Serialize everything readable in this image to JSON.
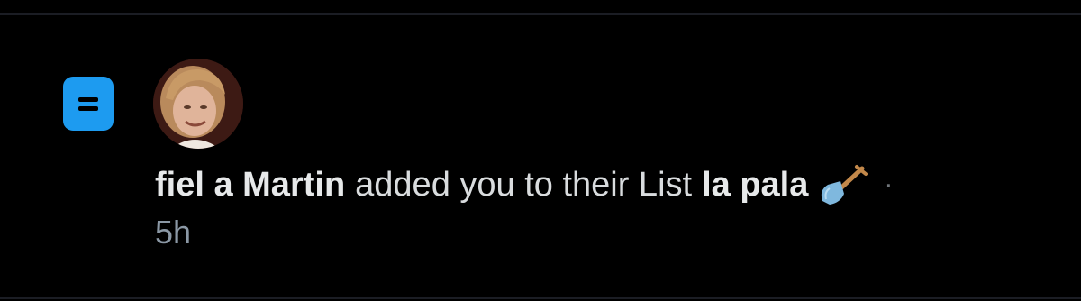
{
  "notification": {
    "icon": "list-icon",
    "avatar_icon": "user-avatar",
    "user_name": "fiel a Martin",
    "action_text": "added you to their List",
    "list_name": "la pala",
    "list_emoji_icon": "shovel-icon",
    "separator": "·",
    "timestamp": "5h"
  },
  "colors": {
    "background": "#000000",
    "accent": "#1d9bf0",
    "primary_text": "#e7e9ea",
    "secondary_text": "#8b98a5",
    "divider": "#1b1d24"
  }
}
